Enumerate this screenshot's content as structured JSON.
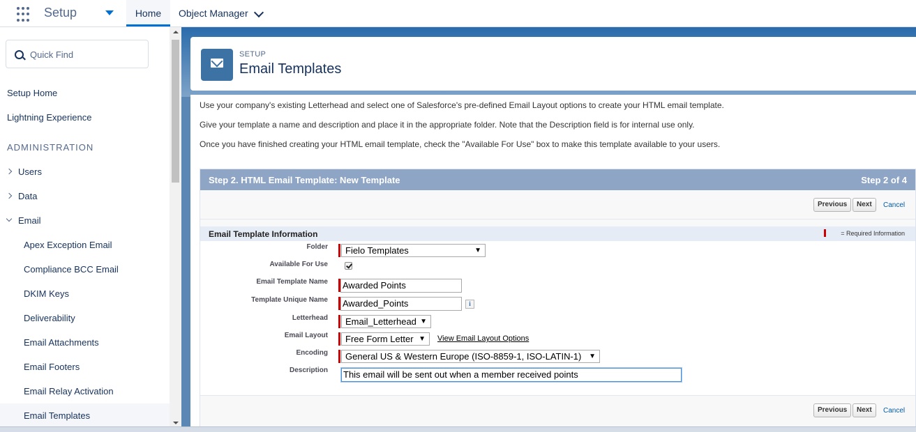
{
  "topbar": {
    "app_name": "Setup",
    "tabs": [
      {
        "label": "Home"
      },
      {
        "label": "Object Manager"
      }
    ]
  },
  "sidebar": {
    "quick_find_placeholder": "Quick Find",
    "links": [
      {
        "label": "Setup Home"
      },
      {
        "label": "Lightning Experience"
      }
    ],
    "section_heading": "ADMINISTRATION",
    "tree": [
      {
        "label": "Users"
      },
      {
        "label": "Data"
      },
      {
        "label": "Email"
      }
    ],
    "email_children": [
      {
        "label": "Apex Exception Email"
      },
      {
        "label": "Compliance BCC Email"
      },
      {
        "label": "DKIM Keys"
      },
      {
        "label": "Deliverability"
      },
      {
        "label": "Email Attachments"
      },
      {
        "label": "Email Footers"
      },
      {
        "label": "Email Relay Activation"
      },
      {
        "label": "Email Templates"
      }
    ],
    "active_item": "Email Templates"
  },
  "header": {
    "eyebrow": "SETUP",
    "title": "Email Templates",
    "icon": "envelope-icon",
    "icon_color": "#3c73a4"
  },
  "instructions": [
    "Use your company's existing Letterhead and select one of Salesforce's pre-defined Email Layout options to create your HTML email template.",
    "Give your template a name and description and place it in the appropriate folder. Note that the Description field is for internal use only.",
    "Once you have finished creating your HTML email template, check the \"Available For Use\" box to make this template available to your users."
  ],
  "step": {
    "title": "Step 2. HTML Email Template: New Template",
    "count": "Step 2 of 4",
    "previous_label": "Previous",
    "next_label": "Next",
    "cancel_label": "Cancel",
    "section_title": "Email Template Information",
    "required_text": "= Required Information"
  },
  "form": {
    "folder": {
      "label": "Folder",
      "value": "Fielo Templates"
    },
    "available": {
      "label": "Available For Use",
      "checked": true
    },
    "template_name": {
      "label": "Email Template Name",
      "value": "Awarded Points"
    },
    "unique_name": {
      "label": "Template Unique Name",
      "value": "Awarded_Points",
      "info": "i"
    },
    "letterhead": {
      "label": "Letterhead",
      "value": "Email_Letterhead"
    },
    "email_layout": {
      "label": "Email Layout",
      "value": "Free Form Letter",
      "link": "View Email Layout Options"
    },
    "encoding": {
      "label": "Encoding",
      "value": "General US & Western Europe (ISO-8859-1, ISO-LATIN-1)"
    },
    "description": {
      "label": "Description",
      "value": "This email will be sent out when a member received points"
    }
  },
  "colors": {
    "accent": "#0070d2",
    "step_bar": "#8fa5c6",
    "required": "#cc0000"
  }
}
